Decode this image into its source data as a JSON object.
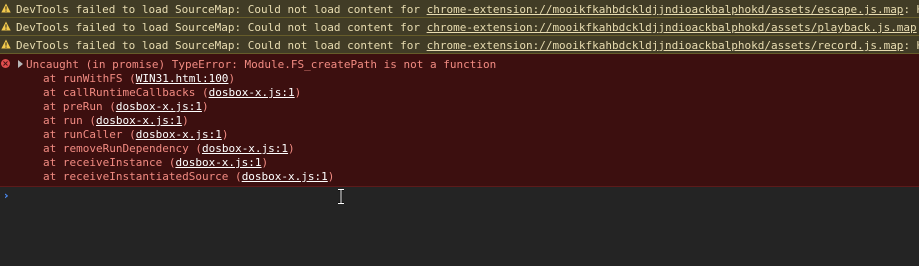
{
  "warnings": [
    {
      "text": "DevTools failed to load SourceMap: Could not load content for ",
      "url": "chrome-extension://mooikfkahbdckldjjndioackbalphokd/assets/escape.js.map",
      "suffix": ": H"
    },
    {
      "text": "DevTools failed to load SourceMap: Could not load content for ",
      "url": "chrome-extension://mooikfkahbdckldjjndioackbalphokd/assets/playback.js.map",
      "suffix": ": H"
    },
    {
      "text": "DevTools failed to load SourceMap: Could not load content for ",
      "url": "chrome-extension://mooikfkahbdckldjjndioackbalphokd/assets/record.js.map",
      "suffix": ": H"
    }
  ],
  "error": {
    "message": "Uncaught (in promise) TypeError: Module.FS_createPath is not a function",
    "stack": [
      {
        "prefix": "at runWithFS (",
        "source": "WIN31.html:100",
        "suffix": ")"
      },
      {
        "prefix": "at callRuntimeCallbacks (",
        "source": "dosbox-x.js:1",
        "suffix": ")"
      },
      {
        "prefix": "at preRun (",
        "source": "dosbox-x.js:1",
        "suffix": ")"
      },
      {
        "prefix": "at run (",
        "source": "dosbox-x.js:1",
        "suffix": ")"
      },
      {
        "prefix": "at runCaller (",
        "source": "dosbox-x.js:1",
        "suffix": ")"
      },
      {
        "prefix": "at removeRunDependency (",
        "source": "dosbox-x.js:1",
        "suffix": ")"
      },
      {
        "prefix": "at receiveInstance (",
        "source": "dosbox-x.js:1",
        "suffix": ")"
      },
      {
        "prefix": "at receiveInstantiatedSource (",
        "source": "dosbox-x.js:1",
        "suffix": ")"
      }
    ]
  },
  "prompt": {
    "chevron": "›",
    "value": ""
  },
  "colors": {
    "background": "#242424",
    "warning_bg": "#413c26",
    "warning_text": "#e8dcb0",
    "error_bg": "#3c0f0f",
    "error_text": "#f28b82",
    "prompt_accent": "#4d90fe"
  },
  "icons": {
    "warning": "warning-triangle-icon",
    "error": "error-circle-icon",
    "expand": "expand-triangle-icon",
    "prompt": "chevron-right-icon",
    "cursor": "text-ibeam-cursor-icon"
  }
}
